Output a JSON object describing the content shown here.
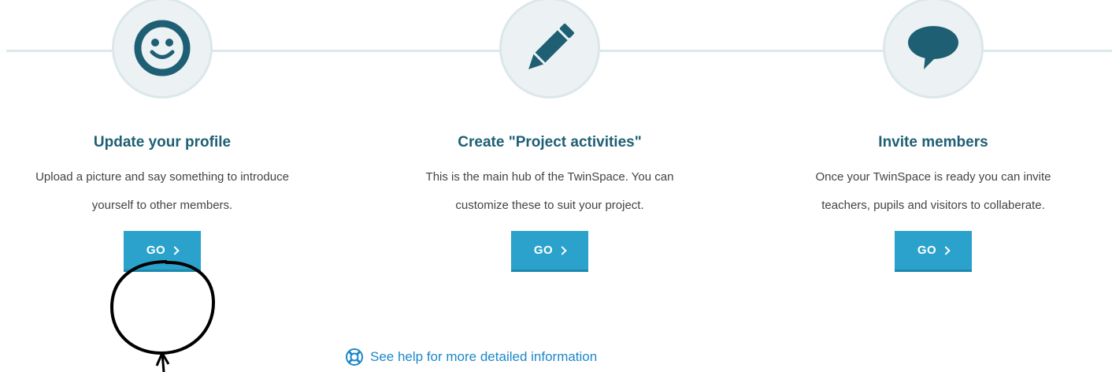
{
  "steps": [
    {
      "title": "Update your profile",
      "description": "Upload a picture and say something to introduce yourself to other members.",
      "icon": "smiley-icon",
      "button_label": "GO"
    },
    {
      "title": "Create \"Project activities\"",
      "description": "This is the main hub of the TwinSpace. You can customize these to suit your project.",
      "icon": "pencil-icon",
      "button_label": "GO"
    },
    {
      "title": "Invite members",
      "description": "Once your TwinSpace is ready you can invite teachers, pupils and visitors to collaberate.",
      "icon": "speech-bubble-icon",
      "button_label": "GO"
    }
  ],
  "help": {
    "label": "See help for more detailed information",
    "icon": "lifebuoy-icon"
  },
  "colors": {
    "accent": "#2aa2cb",
    "title": "#1e5f74",
    "icon": "#1e5f74",
    "link": "#1f87c8",
    "circle_bg": "#ecf1f4",
    "connector": "#dbe7ea"
  }
}
